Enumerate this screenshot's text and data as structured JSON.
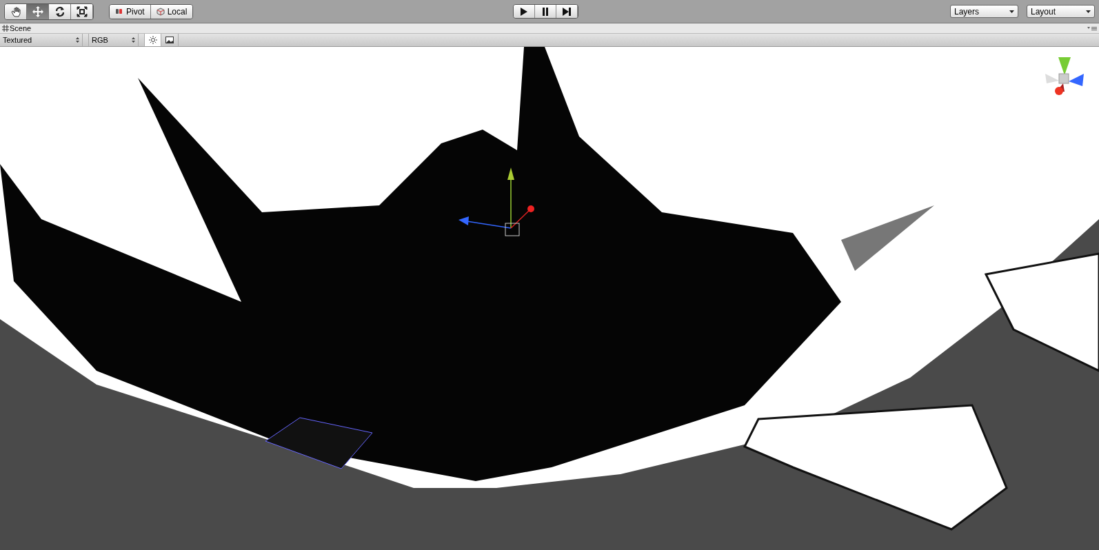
{
  "toolbar": {
    "tools": [
      {
        "kind": "hand",
        "selected": false
      },
      {
        "kind": "move",
        "selected": true
      },
      {
        "kind": "rotate",
        "selected": false
      },
      {
        "kind": "scale",
        "selected": false
      }
    ],
    "pivot": {
      "label": "Pivot"
    },
    "space": {
      "label": "Local"
    },
    "playback": [
      {
        "kind": "play"
      },
      {
        "kind": "pause"
      },
      {
        "kind": "step"
      }
    ],
    "layers": {
      "label": "Layers"
    },
    "layout": {
      "label": "Layout"
    }
  },
  "scene_tab": {
    "label": "Scene"
  },
  "scene_controls": {
    "draw_mode": "Textured",
    "render_mode": "RGB",
    "lighting": {
      "on": true
    },
    "effects": {
      "on": false
    }
  }
}
